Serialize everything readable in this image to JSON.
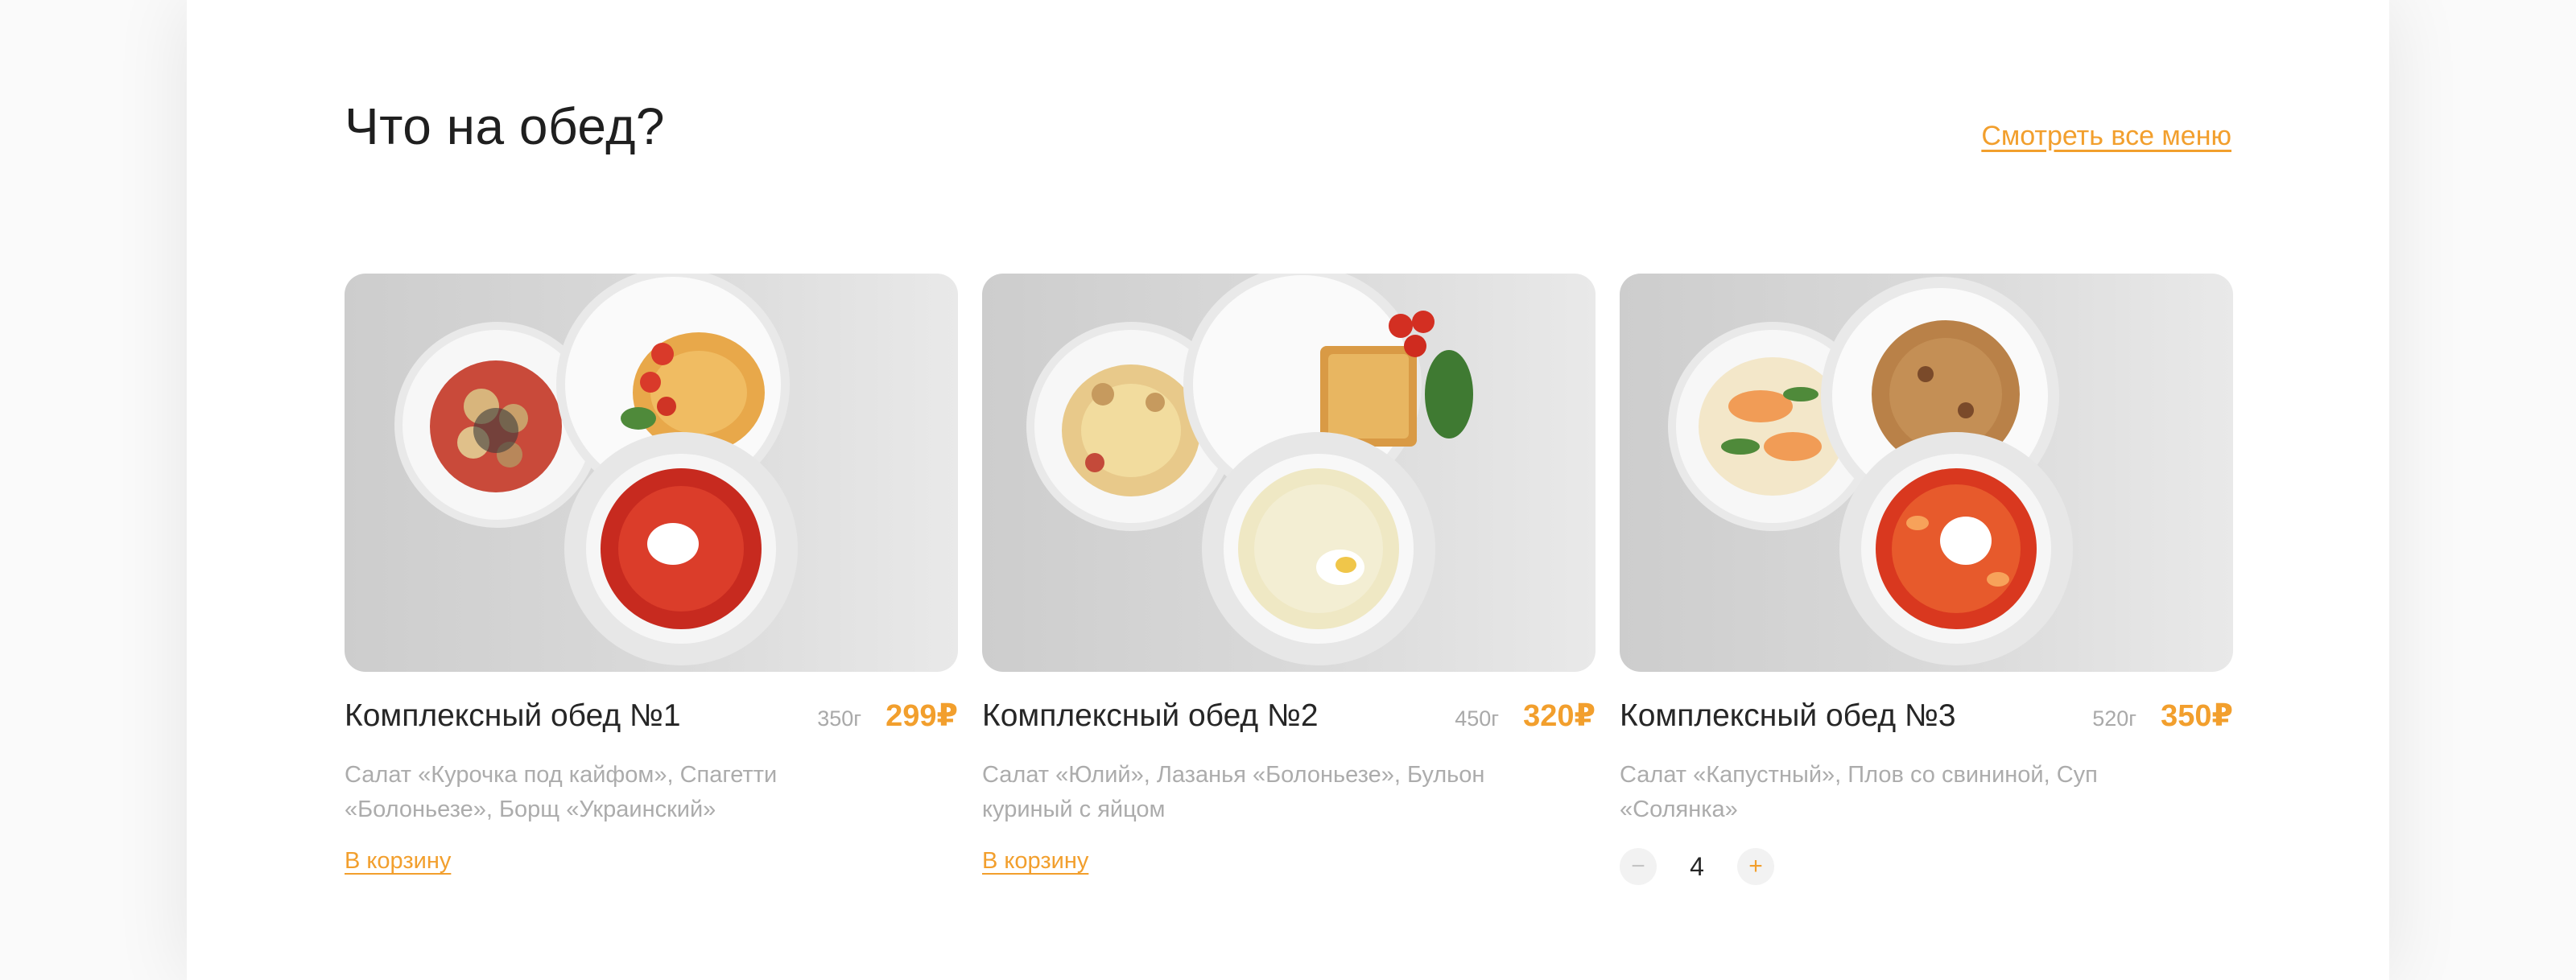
{
  "section": {
    "title": "Что на обед?",
    "see_all_label": "Смотреть все меню"
  },
  "colors": {
    "accent": "#f29f2d",
    "muted_text": "#acacac",
    "card_bg": "#d6d6d6"
  },
  "cards": [
    {
      "title": "Комплексный обед №1",
      "weight": "350г",
      "price": "299₽",
      "description": "Салат «Курочка под кайфом», Спагетти «Болоньезе», Борщ «Украинский»",
      "action_label": "В корзину"
    },
    {
      "title": "Комплексный обед №2",
      "weight": "450г",
      "price": "320₽",
      "description": "Салат «Юлий», Лазанья «Болоньезе», Бульон куриный с яйцом",
      "action_label": "В корзину"
    },
    {
      "title": "Комплексный обед №3",
      "weight": "520г",
      "price": "350₽",
      "description": "Салат «Капустный», Плов со свининой, Суп «Солянка»",
      "quantity": "4",
      "minus_symbol": "−",
      "plus_symbol": "+"
    }
  ]
}
